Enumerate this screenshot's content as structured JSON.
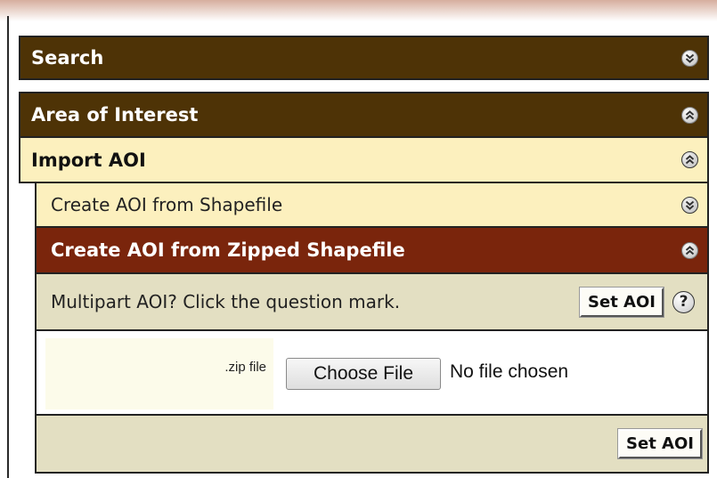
{
  "panels": {
    "search": {
      "label": "Search",
      "icon": "chevron-double-down-icon"
    },
    "area_of_interest": {
      "label": "Area of Interest",
      "icon": "chevron-double-up-icon"
    },
    "import_aoi": {
      "label": "Import AOI",
      "icon": "chevron-double-up-icon"
    },
    "create_from_shapefile": {
      "label": "Create AOI from Shapefile",
      "icon": "chevron-double-down-icon"
    },
    "create_from_zipped": {
      "label": "Create AOI from Zipped Shapefile",
      "icon": "chevron-double-up-icon"
    }
  },
  "multipart": {
    "message": "Multipart AOI? Click the question mark.",
    "set_aoi_label": "Set AOI",
    "help_glyph": "?"
  },
  "file_input": {
    "label": ".zip file",
    "button_label": "Choose File",
    "status": "No file chosen"
  },
  "footer": {
    "set_aoi_label": "Set AOI"
  },
  "colors": {
    "header_dark": "#4e3306",
    "header_active": "#7a250c",
    "header_light": "#fcf0be",
    "row_tan": "#e3dfc2"
  }
}
